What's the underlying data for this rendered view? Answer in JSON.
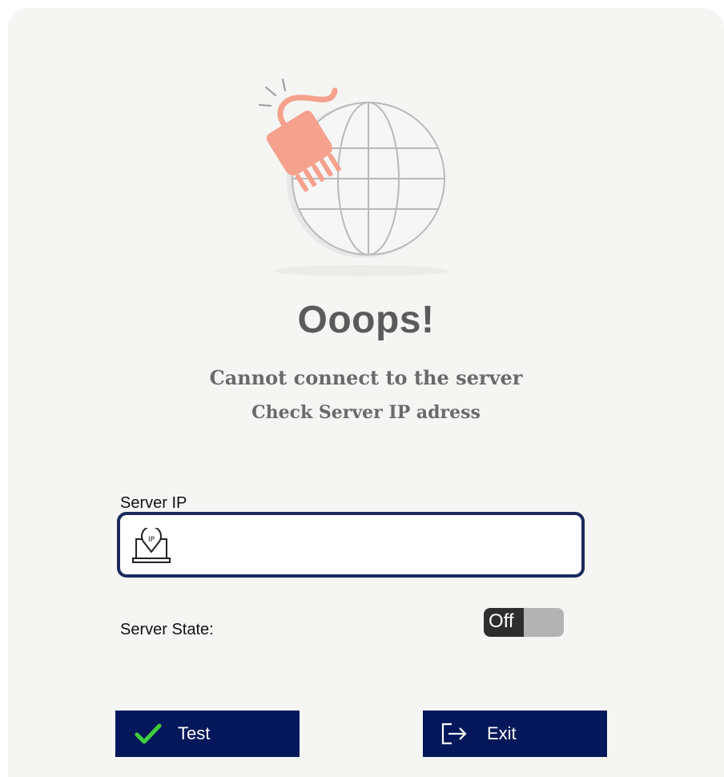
{
  "error": {
    "title": "Ooops!",
    "message": "Cannot connect to the server",
    "hint": "Check Server IP adress"
  },
  "form": {
    "server_ip_label": "Server IP",
    "server_ip_value": "",
    "server_ip_placeholder": "",
    "server_ip_icon": "ip-laptop-icon",
    "server_state_label": "Server State:",
    "server_state_value": "Off"
  },
  "buttons": {
    "test_label": "Test",
    "test_icon": "checkmark-icon",
    "exit_label": "Exit",
    "exit_icon": "exit-arrow-icon"
  },
  "colors": {
    "background": "#f5f5f3",
    "button": "#03175a",
    "field_border": "#1a2a5c",
    "check": "#3fcf3a",
    "plug": "#f5a18d"
  }
}
